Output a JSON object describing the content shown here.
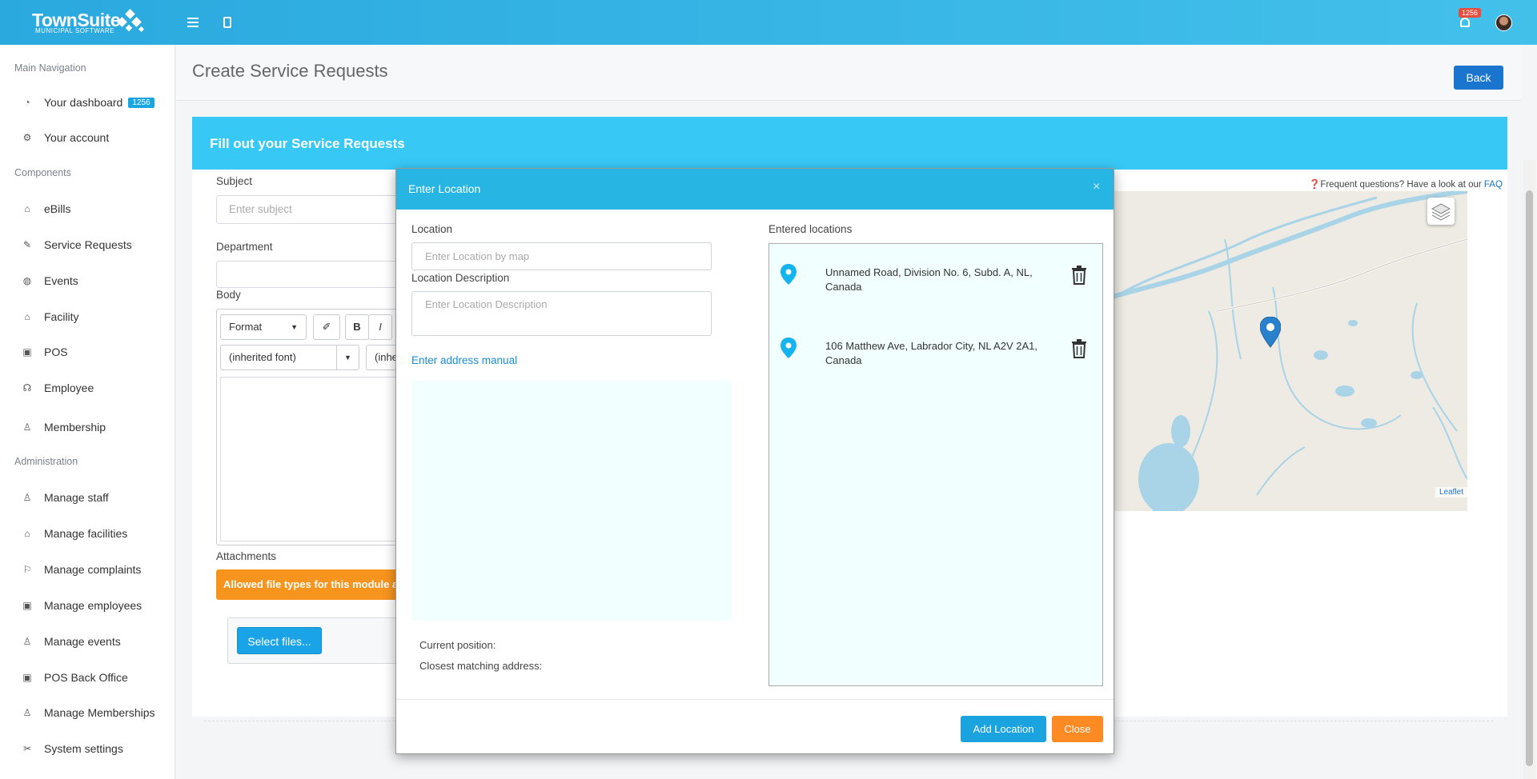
{
  "header": {
    "brand": "TownSuite",
    "brand_sub": "MUNICIPAL SOFTWARE",
    "notification_count": "1256",
    "accent": "#2aa9df"
  },
  "sidebar": {
    "sections": [
      {
        "title": "Main Navigation"
      },
      {
        "title": "Components"
      },
      {
        "title": "Administration"
      }
    ],
    "items": [
      {
        "label": "Your dashboard",
        "icon": "dashboard-icon",
        "badge": "1256"
      },
      {
        "label": "Your account",
        "icon": "gear-icon"
      },
      {
        "label": "eBills",
        "icon": "bills-icon"
      },
      {
        "label": "Service Requests",
        "icon": "edit-icon"
      },
      {
        "label": "Events",
        "icon": "globe-icon"
      },
      {
        "label": "Facility",
        "icon": "home-icon"
      },
      {
        "label": "POS",
        "icon": "briefcase-icon"
      },
      {
        "label": "Employee",
        "icon": "headset-icon"
      },
      {
        "label": "Membership",
        "icon": "user-icon"
      },
      {
        "label": "Manage staff",
        "icon": "user-gear-icon"
      },
      {
        "label": "Manage facilities",
        "icon": "home-icon"
      },
      {
        "label": "Manage complaints",
        "icon": "flag-icon"
      },
      {
        "label": "Manage employees",
        "icon": "briefcase-icon"
      },
      {
        "label": "Manage events",
        "icon": "user-gear-icon"
      },
      {
        "label": "POS Back Office",
        "icon": "briefcase-icon"
      },
      {
        "label": "Manage Memberships",
        "icon": "user-icon"
      },
      {
        "label": "System settings",
        "icon": "wrench-icon"
      }
    ]
  },
  "page": {
    "title": "Create Service Requests",
    "back_label": "Back"
  },
  "form": {
    "card_title": "Fill out your Service Requests",
    "subject_label": "Subject",
    "subject_placeholder": "Enter subject",
    "department_label": "Department",
    "body_label": "Body",
    "format_label": "Format",
    "bold_label": "B",
    "italic_label": "I",
    "font_label": "(inherited font)",
    "size_label": "(inhe",
    "attachments_label": "Attachments",
    "allowed_types_text": "Allowed file types for this module ar",
    "select_files_label": "Select files...",
    "faq_text": "Frequent questions? Have a look at our ",
    "faq_link": "FAQ",
    "leaflet_link": "Leaflet"
  },
  "modal": {
    "title": "Enter Location",
    "close_glyph": "×",
    "location_label": "Location",
    "location_placeholder": "Enter Location by map",
    "description_label": "Location Description",
    "description_placeholder": "Enter Location Description",
    "manual_link": "Enter address manual",
    "current_position_label": "Current position:",
    "closest_address_label": "Closest matching address:",
    "entered_locations_label": "Entered locations",
    "locations": [
      {
        "line1": "Unnamed Road, Division No. 6, Subd. A, NL,",
        "line2": "Canada"
      },
      {
        "line1": "106 Matthew Ave, Labrador City, NL A2V 2A1,",
        "line2": "Canada"
      }
    ],
    "add_label": "Add Location",
    "close_label": "Close"
  }
}
